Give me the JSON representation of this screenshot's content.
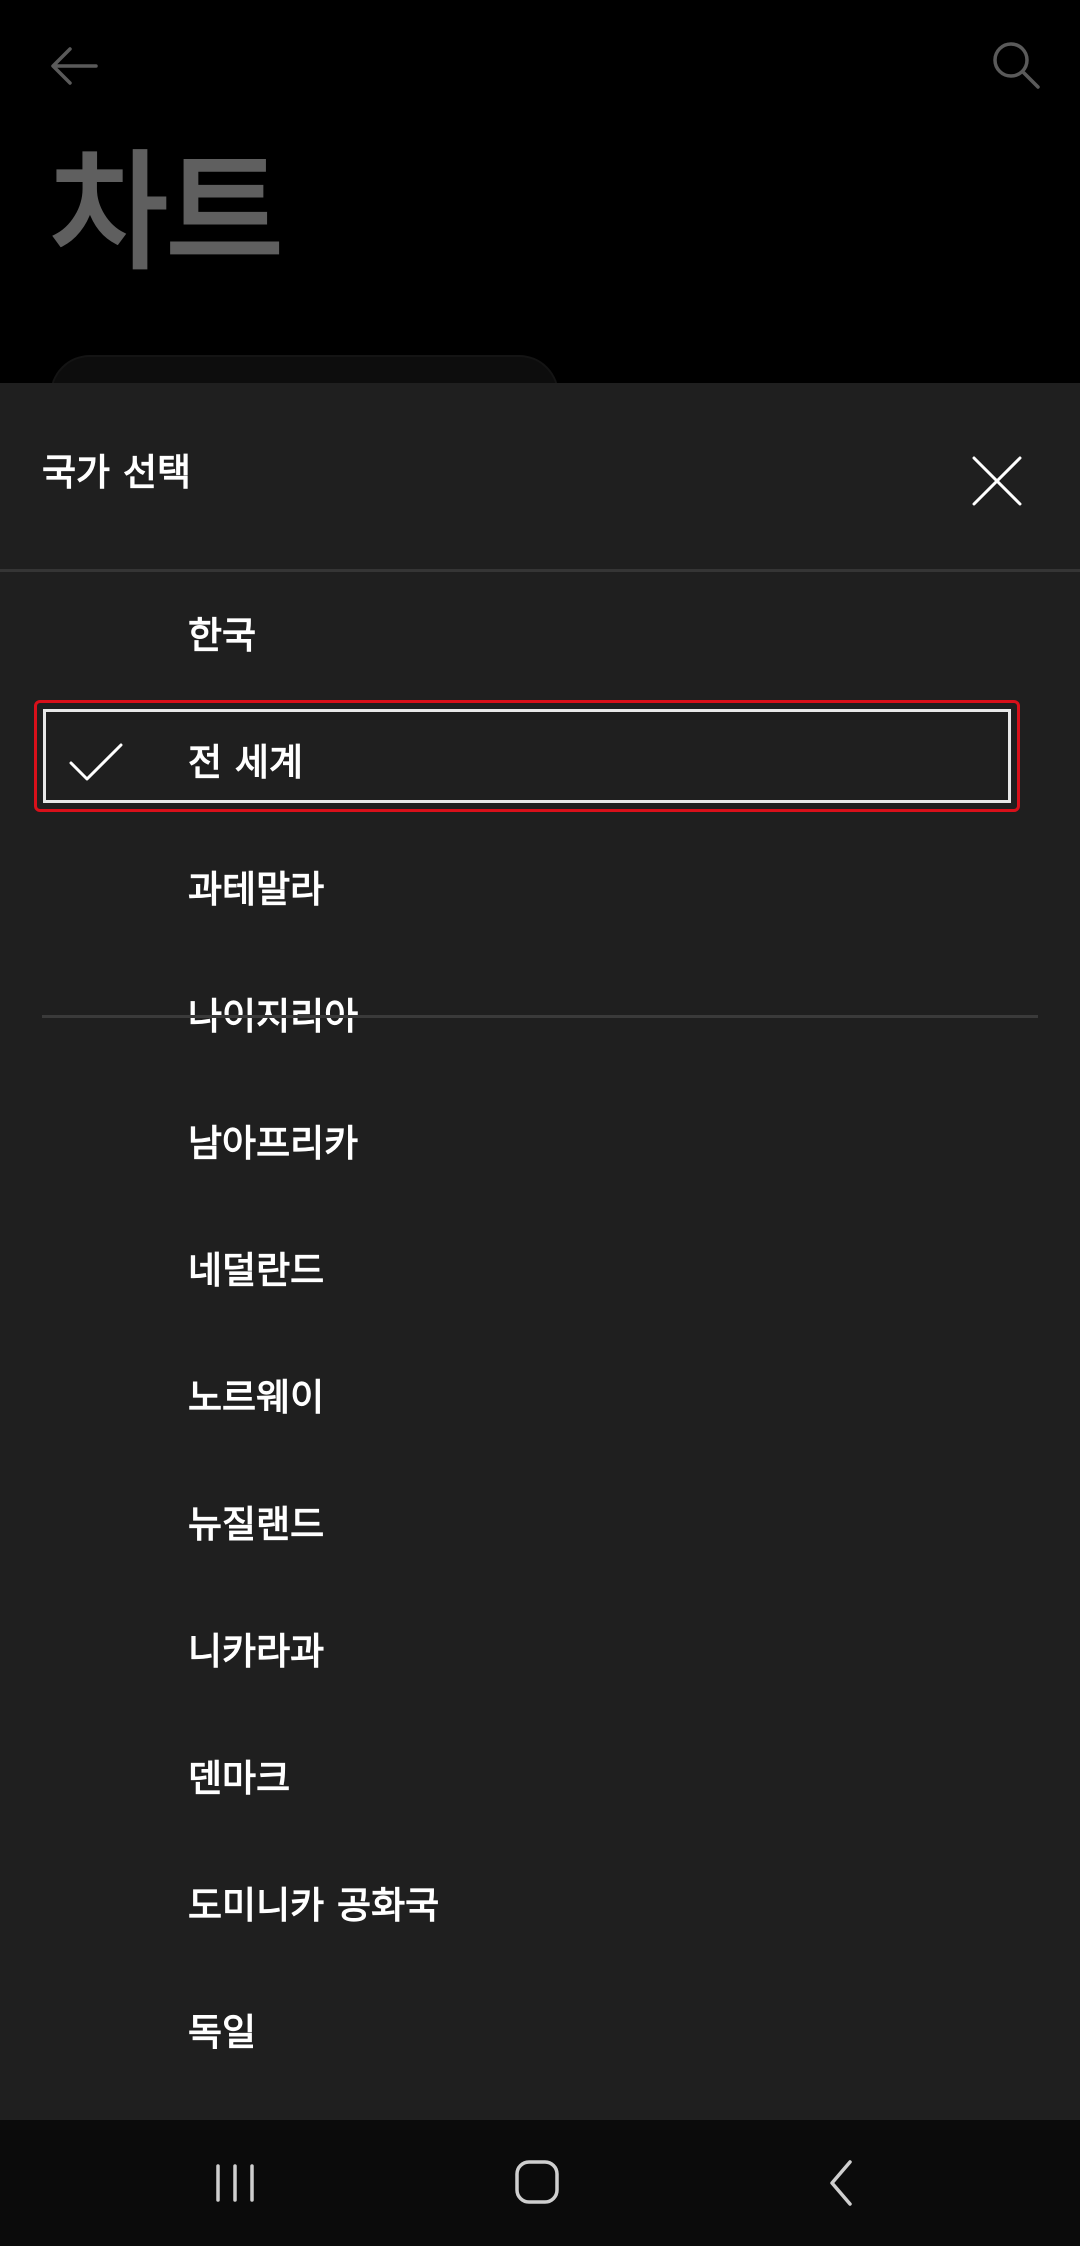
{
  "page": {
    "title": "차트"
  },
  "sheet": {
    "title": "국가 선택",
    "selected_index": 1,
    "countries": [
      "한국",
      "전 세계",
      "과테말라",
      "나이지리아",
      "남아프리카",
      "네덜란드",
      "노르웨이",
      "뉴질랜드",
      "니카라과",
      "덴마크",
      "도미니카 공화국",
      "독일"
    ]
  },
  "icons": {
    "back": "arrow-left-icon",
    "search": "search-icon",
    "close": "close-icon",
    "check": "check-icon",
    "nav_recents": "recents-icon",
    "nav_home": "home-icon",
    "nav_back": "nav-back-icon"
  },
  "colors": {
    "sheet_bg": "#1f1f1f",
    "highlight_border": "#d8101a"
  }
}
